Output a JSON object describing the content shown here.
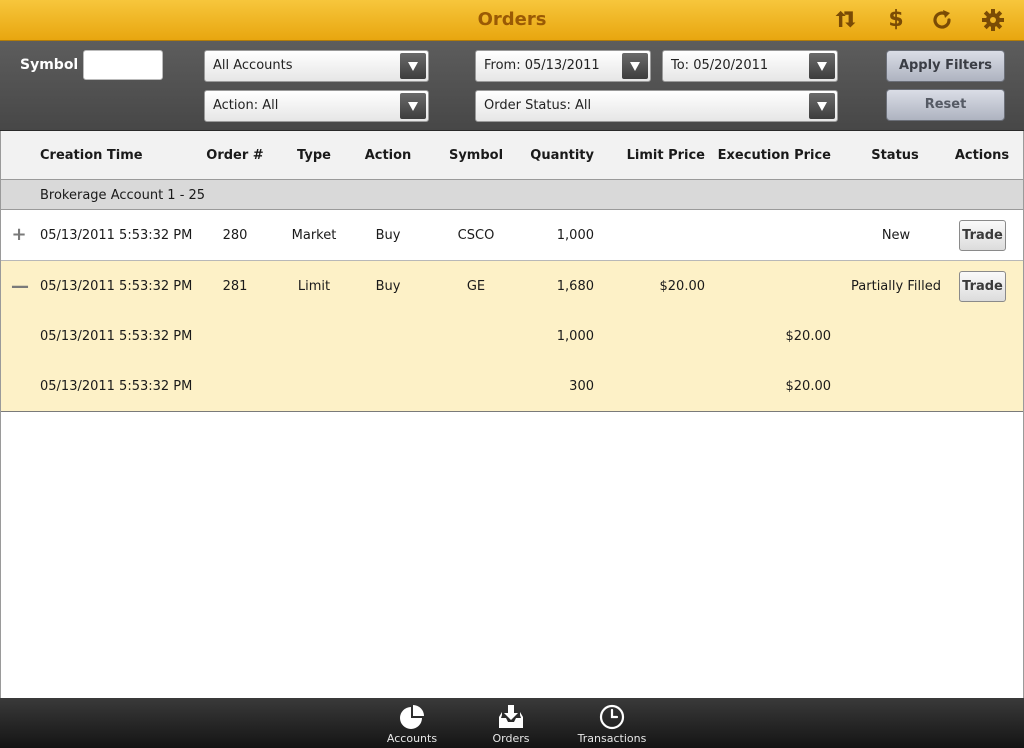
{
  "header": {
    "title": "Orders",
    "icons": [
      "swap-arrows-icon",
      "dollar-icon",
      "refresh-icon",
      "gear-icon"
    ],
    "dollar_symbol": "$"
  },
  "filters": {
    "symbol_label": "Symbol",
    "symbol_value": "",
    "account": "All Accounts",
    "action": "Action: All",
    "from": "From: 05/13/2011",
    "to": "To: 05/20/2011",
    "order_status": "Order Status: All",
    "apply_label": "Apply Filters",
    "reset_label": "Reset"
  },
  "table": {
    "columns": [
      "Creation Time",
      "Order #",
      "Type",
      "Action",
      "Symbol",
      "Quantity",
      "Limit Price",
      "Execution Price",
      "Status",
      "Actions"
    ],
    "group_label": "Brokerage Account 1 - 25",
    "orders": [
      {
        "toggle": "+",
        "creation_time": "05/13/2011 5:53:32 PM",
        "order_no": "280",
        "type": "Market",
        "action": "Buy",
        "symbol": "CSCO",
        "quantity": "1,000",
        "limit_price": "",
        "execution_price": "",
        "status": "New",
        "action_button": "Trade"
      },
      {
        "toggle": "—",
        "creation_time": "05/13/2011 5:53:32 PM",
        "order_no": "281",
        "type": "Limit",
        "action": "Buy",
        "symbol": "GE",
        "quantity": "1,680",
        "limit_price": "$20.00",
        "execution_price": "",
        "status": "Partially Filled",
        "action_button": "Trade",
        "executions": [
          {
            "creation_time": "05/13/2011 5:53:32 PM",
            "quantity": "1,000",
            "execution_price": "$20.00"
          },
          {
            "creation_time": "05/13/2011 5:53:32 PM",
            "quantity": "300",
            "execution_price": "$20.00"
          }
        ]
      }
    ]
  },
  "tabbar": {
    "tabs": [
      {
        "label": "Accounts",
        "icon": "pie-chart-icon"
      },
      {
        "label": "Orders",
        "icon": "inbox-download-icon"
      },
      {
        "label": "Transactions",
        "icon": "clock-icon"
      }
    ]
  },
  "colors": {
    "header_gold": "#f0b625",
    "title_text": "#9a5a05",
    "filter_bar": "#525252",
    "expanded_row": "#fdf1c7",
    "group_row": "#d9d9d9"
  }
}
